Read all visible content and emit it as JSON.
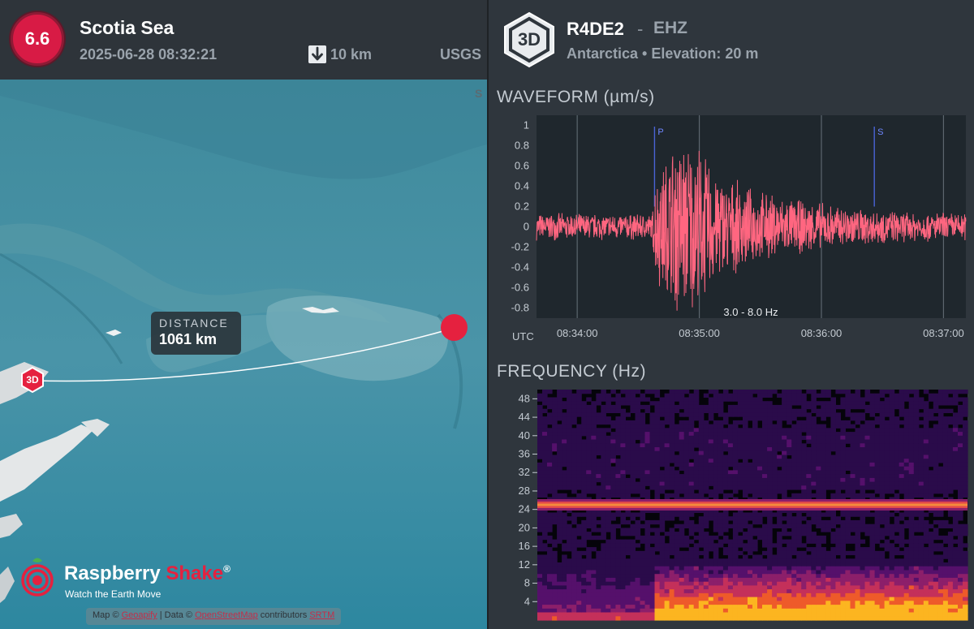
{
  "event": {
    "magnitude": "6.6",
    "region": "Scotia Sea",
    "datetime": "2025-06-28 08:32:21",
    "depth": "10 km",
    "source": "USGS",
    "color": "#d81b45"
  },
  "map": {
    "distance_label": "DISTANCE",
    "distance_value": "1061 km",
    "station_marker_label": "3D",
    "brand_name_part1": "Raspberry ",
    "brand_name_part2": "Shake",
    "brand_reg": "®",
    "brand_tagline": "Watch the Earth Move",
    "attribution": {
      "prefix": "Map © ",
      "link1": "Geoapify",
      "mid1": " | Data © ",
      "link2": "OpenStreetMap",
      "mid2": " contributors ",
      "link3": "SRTM"
    },
    "colors": {
      "ocean": "#3f8fa3",
      "route": "#ffffff",
      "epicenter": "#e5213f"
    }
  },
  "station": {
    "badge": "3D",
    "code": "R4DE2",
    "separator": "-",
    "channel": "EHZ",
    "location": "Antarctica • Elevation: 20 m"
  },
  "waveform": {
    "title": "WAVEFORM (µm/s)",
    "filter_label": "3.0 - 8.0 Hz",
    "time_axis_label": "UTC",
    "p_label": "P",
    "s_label": "S",
    "color": "#ff6680"
  },
  "spectrogram": {
    "title": "FREQUENCY (Hz)"
  },
  "chart_data": [
    {
      "type": "line",
      "name": "waveform",
      "xlabel": "UTC",
      "ylabel": "",
      "ylim": [
        -0.9,
        1.1
      ],
      "y_ticks": [
        1,
        0.8,
        0.6,
        0.4,
        0.2,
        0,
        -0.2,
        -0.4,
        -0.6,
        -0.8
      ],
      "x_ticks": [
        "08:34:00",
        "08:35:00",
        "08:36:00",
        "08:37:00"
      ],
      "xlim": [
        "08:33:40",
        "08:37:11"
      ],
      "phase_markers": [
        {
          "label": "P",
          "time": "08:34:38"
        },
        {
          "label": "S",
          "time": "08:36:26"
        }
      ],
      "envelope": {
        "times": [
          "08:33:40",
          "08:34:37",
          "08:34:38",
          "08:34:50",
          "08:35:00",
          "08:35:10",
          "08:35:25",
          "08:35:45",
          "08:36:10",
          "08:36:40",
          "08:37:11"
        ],
        "amplitude": [
          0.14,
          0.14,
          0.55,
          1.0,
          0.85,
          0.55,
          0.4,
          0.3,
          0.22,
          0.16,
          0.15
        ]
      },
      "grid": true
    },
    {
      "type": "heatmap",
      "name": "spectrogram",
      "ylabel": "FREQUENCY (Hz)",
      "ylim": [
        0,
        50
      ],
      "y_ticks": [
        48,
        44,
        40,
        36,
        32,
        28,
        24,
        20,
        16,
        12,
        8,
        4
      ],
      "constant_band_hz": 25,
      "onset_time": "08:34:38",
      "colormap": "inferno"
    }
  ]
}
